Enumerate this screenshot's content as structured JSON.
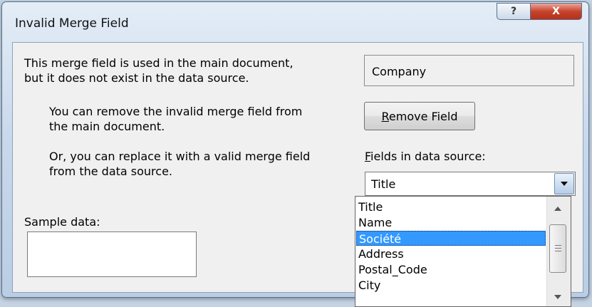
{
  "window": {
    "title": "Invalid Merge Field",
    "help_label": "?",
    "close_label": "X"
  },
  "message": {
    "line1": "This merge field is used in the main document,",
    "line2": "but it does not exist in the data source.",
    "remove_line1": "You can remove the invalid merge field from",
    "remove_line2": "the main document.",
    "replace_line1": "Or, you can replace it with a valid merge field",
    "replace_line2": "from the data source."
  },
  "field_name": "Company",
  "remove_button": {
    "mnemonic": "R",
    "rest": "emove Field"
  },
  "fields_label": {
    "mnemonic": "F",
    "rest": "ields in data source:"
  },
  "combo": {
    "selected": "Title"
  },
  "dropdown": {
    "options": [
      "Title",
      "Name",
      "Société",
      "Address",
      "Postal_Code",
      "City"
    ],
    "highlighted_index": 2
  },
  "sample": {
    "label": "Sample data:",
    "value": ""
  },
  "icons": {
    "close": "close-icon",
    "help": "help-icon",
    "dropdown": "chevron-down-icon",
    "scroll_up": "scroll-up-icon",
    "scroll_down": "scroll-down-icon"
  }
}
